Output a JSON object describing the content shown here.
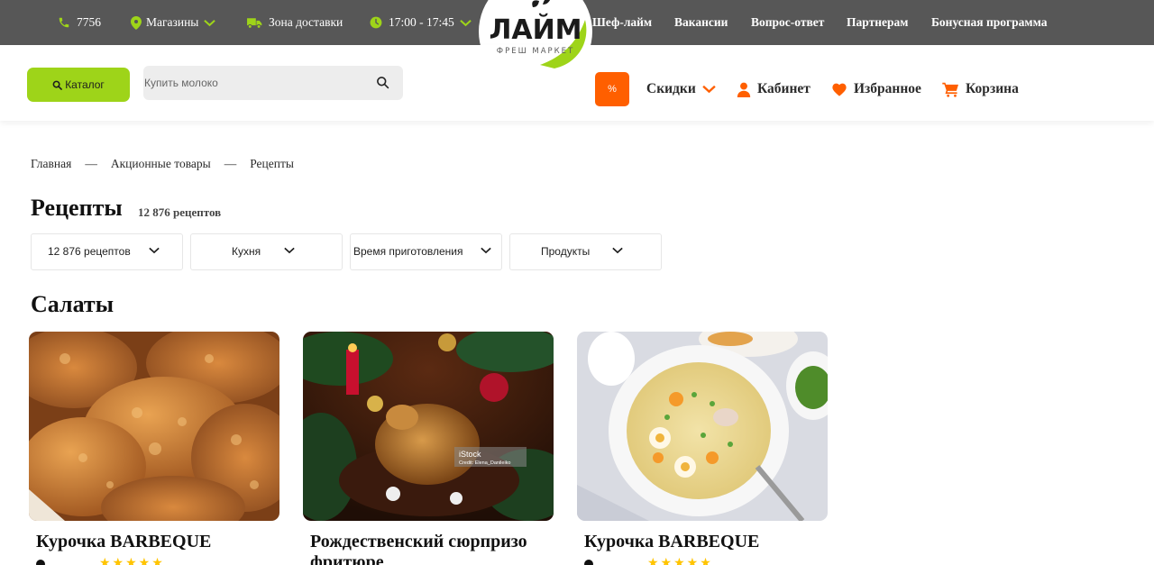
{
  "topbar": {
    "phone": "7756",
    "stores": "Магазины",
    "delivery_zone": "Зона доставки",
    "time_slot": "17:00 - 17:45",
    "links": [
      "Шеф-лайм",
      "Вакансии",
      "Вопрос-ответ",
      "Партнерам",
      "Бонусная программа"
    ]
  },
  "logo": {
    "title": "ЛАЙМ",
    "subtitle": "ФРЕШ МАРКЕТ"
  },
  "header": {
    "catalog_label": "Каталог",
    "search_placeholder": "Купить молоко",
    "percent_label": "%",
    "discounts": "Скидки",
    "cabinet": "Кабинет",
    "favorites": "Избранное",
    "cart": "Корзина"
  },
  "breadcrumb": [
    "Главная",
    "Акционные товары",
    "Рецепты"
  ],
  "breadcrumb_separator": "—",
  "page": {
    "title": "Рецепты",
    "count": "12 876 рецептов"
  },
  "filters": [
    "12 876 рецептов",
    "Кухня",
    "Время приготовления",
    "Продукты"
  ],
  "section_title": "Салаты",
  "cards": [
    {
      "title": "Курочка BARBEQUE",
      "image": "fried-chicken-photo"
    },
    {
      "title": "Рождественский сюрпризо фритюре",
      "image": "roast-chicken-photo",
      "watermark": "iStock",
      "watermark_credit": "Credit: Elena_Danileiko"
    },
    {
      "title": "Курочка BARBEQUE",
      "image": "noodle-soup-photo"
    }
  ],
  "colors": {
    "topbar": "#575757",
    "accent_green": "#9ed419",
    "accent_orange": "#ff5f00"
  },
  "icons": [
    "phone-icon",
    "location-pin-icon",
    "truck-icon",
    "clock-icon",
    "chevron-down-icon",
    "search-icon",
    "user-icon",
    "heart-icon",
    "cart-icon"
  ]
}
